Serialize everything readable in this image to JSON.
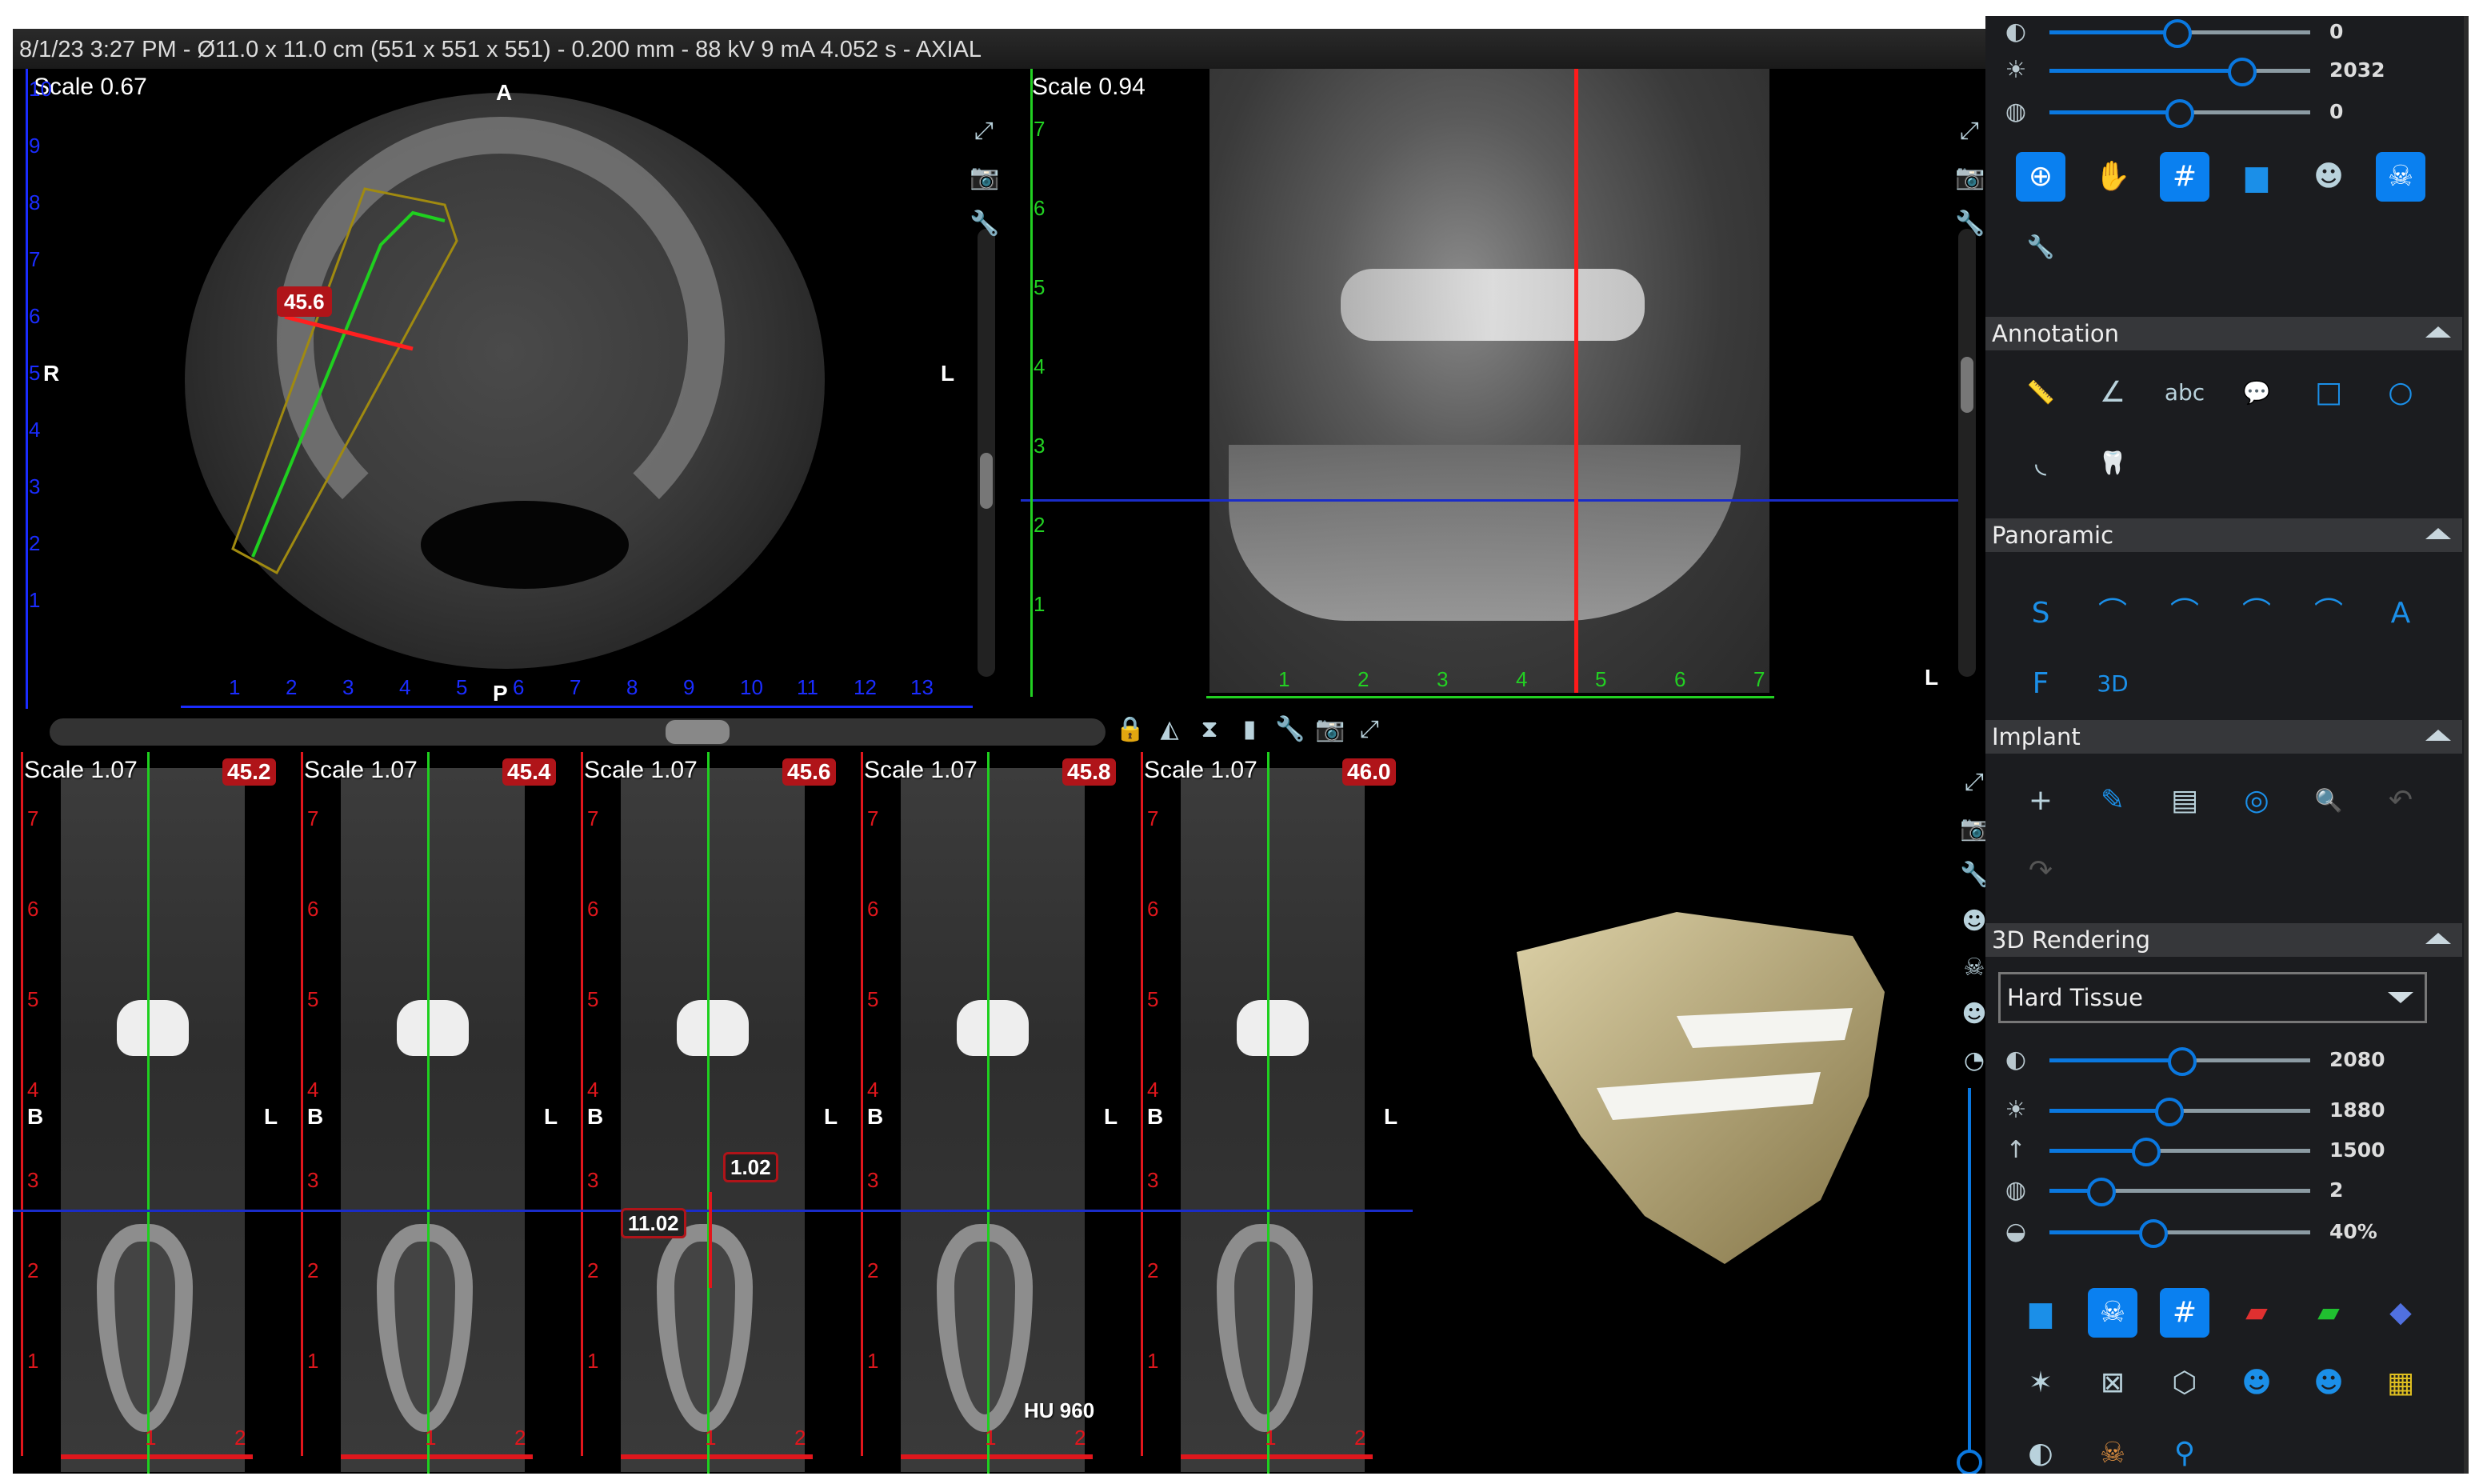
{
  "info_bar": "8/1/23 3:27 PM - Ø11.0 x 11.0 cm (551 x 551 x 551) - 0.200 mm - 88 kV 9 mA 4.052 s - AXIAL",
  "axial": {
    "scale": "Scale 0.67",
    "orient": {
      "top": "A",
      "bottom": "P",
      "left": "R",
      "right": "L"
    },
    "left_ruler": [
      "10",
      "9",
      "8",
      "7",
      "6",
      "5",
      "4",
      "3",
      "2",
      "1"
    ],
    "bottom_ruler": [
      "1",
      "2",
      "3",
      "4",
      "5",
      "6",
      "7",
      "8",
      "9",
      "10",
      "11",
      "12",
      "13"
    ],
    "measurement": "45.6",
    "ruler_color": "#1a2cff"
  },
  "sagittal": {
    "scale": "Scale 0.94",
    "orient_right": "L",
    "left_ruler": [
      "7",
      "6",
      "5",
      "4",
      "3",
      "2",
      "1"
    ],
    "bottom_ruler": [
      "1",
      "2",
      "3",
      "4",
      "5",
      "6",
      "7"
    ],
    "ruler_color": "#22d022",
    "slice_line_color": "#ff1a1a"
  },
  "cross_sections": {
    "panels": [
      {
        "scale": "Scale 1.07",
        "slice": "45.2"
      },
      {
        "scale": "Scale 1.07",
        "slice": "45.4"
      },
      {
        "scale": "Scale 1.07",
        "slice": "45.6"
      },
      {
        "scale": "Scale 1.07",
        "slice": "45.8"
      },
      {
        "scale": "Scale 1.07",
        "slice": "46.0"
      }
    ],
    "orient_left": "B",
    "orient_right": "L",
    "left_ruler": [
      "7",
      "6",
      "5",
      "4",
      "3",
      "2",
      "1"
    ],
    "bottom_ruler": [
      "1",
      "2"
    ],
    "measure_width": "1.02",
    "measure_height": "11.02",
    "hu_readout": "HU 960",
    "ruler_color": "#e0161c"
  },
  "view_tools": {
    "axial": [
      "expand-icon",
      "camera-icon",
      "wrench-icon"
    ],
    "sagittal": [
      "expand-icon",
      "camera-icon",
      "wrench-icon"
    ],
    "cross_section_toolbar": [
      "lock-icon",
      "mirror-icon",
      "hourglass-icon",
      "implant-icon",
      "wrench-icon",
      "camera-icon",
      "expand-icon"
    ],
    "render3d": [
      "expand-icon",
      "camera-icon",
      "wrench-icon",
      "head-side-icon",
      "skull-icon",
      "head-icon",
      "head-profile-icon"
    ]
  },
  "panel": {
    "top_sliders": [
      {
        "icon": "contrast-icon",
        "value": "0",
        "fraction": 0.49
      },
      {
        "icon": "brightness-icon",
        "value": "2032",
        "fraction": 0.74
      },
      {
        "icon": "sharpness-icon",
        "value": "0",
        "fraction": 0.5
      }
    ],
    "top_tools": [
      {
        "icon": "zoom-icon",
        "glyph": "⊕",
        "state": "on"
      },
      {
        "icon": "pan-rotate-icon",
        "glyph": "✋",
        "state": "blue"
      },
      {
        "icon": "crosshair-icon",
        "glyph": "#",
        "state": "on"
      },
      {
        "icon": "histogram-icon",
        "glyph": "▆",
        "state": "blue"
      },
      {
        "icon": "head-slice-icon",
        "glyph": "☻",
        "state": ""
      },
      {
        "icon": "skull-icon",
        "glyph": "☠",
        "state": "on"
      },
      {
        "icon": "wrench-icon",
        "glyph": "🔧",
        "state": ""
      }
    ],
    "sections": [
      {
        "title": "Annotation",
        "tools": [
          {
            "icon": "ruler-icon",
            "glyph": "📏",
            "state": ""
          },
          {
            "icon": "angle-icon",
            "glyph": "∠",
            "state": ""
          },
          {
            "icon": "text-annotation-icon",
            "glyph": "abc",
            "state": ""
          },
          {
            "icon": "callout-icon",
            "glyph": "💬",
            "state": "blue"
          },
          {
            "icon": "rectangle-draw-icon",
            "glyph": "□",
            "state": "blue"
          },
          {
            "icon": "ellipse-draw-icon",
            "glyph": "○",
            "state": "blue"
          },
          {
            "icon": "curve-draw-icon",
            "glyph": "◟",
            "state": ""
          },
          {
            "icon": "tooth-annotation-icon",
            "glyph": "🦷",
            "state": ""
          }
        ]
      },
      {
        "title": "Panoramic",
        "tools": [
          {
            "icon": "auto-arch-icon",
            "glyph": "S",
            "state": "blue"
          },
          {
            "icon": "arch-draw-icon",
            "glyph": "⌒",
            "state": "blue"
          },
          {
            "icon": "arch-delete-icon",
            "glyph": "⌒",
            "state": "blue"
          },
          {
            "icon": "arch-move-icon",
            "glyph": "⌒",
            "state": "blue"
          },
          {
            "icon": "arch-report-icon",
            "glyph": "⌒",
            "state": "blue"
          },
          {
            "icon": "arch-auto-icon",
            "glyph": "A",
            "state": "blue"
          },
          {
            "icon": "arch-free-icon",
            "glyph": "F",
            "state": "blue"
          },
          {
            "icon": "panoramic-3d-icon",
            "glyph": "3D",
            "state": "blue"
          }
        ]
      },
      {
        "title": "Implant",
        "tools": [
          {
            "icon": "add-implant-icon",
            "glyph": "+",
            "state": ""
          },
          {
            "icon": "edit-implant-icon",
            "glyph": "✎",
            "state": "blue"
          },
          {
            "icon": "implant-library-icon",
            "glyph": "▤",
            "state": ""
          },
          {
            "icon": "implant-rotate-icon",
            "glyph": "◎",
            "state": "blue"
          },
          {
            "icon": "implant-inspect-icon",
            "glyph": "🔍",
            "state": ""
          },
          {
            "icon": "undo-icon",
            "glyph": "↶",
            "state": "dim"
          },
          {
            "icon": "redo-icon",
            "glyph": "↷",
            "state": "dim"
          }
        ]
      },
      {
        "title": "3D Rendering",
        "dropdown": "Hard Tissue",
        "sliders": [
          {
            "icon": "contrast-icon",
            "value": "2080",
            "fraction": 0.51
          },
          {
            "icon": "brightness-icon",
            "value": "1880",
            "fraction": 0.46
          },
          {
            "icon": "threshold-icon",
            "value": "1500",
            "fraction": 0.37
          },
          {
            "icon": "sharpness-icon",
            "value": "2",
            "fraction": 0.2
          },
          {
            "icon": "opacity-icon",
            "value": "40%",
            "fraction": 0.4
          }
        ],
        "tools": [
          {
            "icon": "histogram-icon",
            "glyph": "▆",
            "state": "blue"
          },
          {
            "icon": "skull-icon",
            "glyph": "☠",
            "state": "on"
          },
          {
            "icon": "crosshair-icon",
            "glyph": "#",
            "state": "on"
          },
          {
            "icon": "red-plane-icon",
            "glyph": "▰",
            "state": "red"
          },
          {
            "icon": "green-plane-icon",
            "glyph": "▰",
            "state": "green"
          },
          {
            "icon": "blue-plane-icon",
            "glyph": "◆",
            "state": "plane"
          },
          {
            "icon": "orientation-cube-icon",
            "glyph": "✶",
            "state": ""
          },
          {
            "icon": "clip-box-icon",
            "glyph": "⊠",
            "state": ""
          },
          {
            "icon": "cube-icon",
            "glyph": "⬡",
            "state": ""
          },
          {
            "icon": "head-front-icon",
            "glyph": "☻",
            "state": "blue"
          },
          {
            "icon": "head-back-icon",
            "glyph": "☻",
            "state": "blue"
          },
          {
            "icon": "color-grid-icon",
            "glyph": "▦",
            "state": "grid"
          },
          {
            "icon": "half-sphere-icon",
            "glyph": "◐",
            "state": ""
          },
          {
            "icon": "skull-color-icon",
            "glyph": "☠",
            "state": "orange"
          },
          {
            "icon": "airway-icon",
            "glyph": "⚲",
            "state": "blue"
          }
        ]
      }
    ]
  }
}
